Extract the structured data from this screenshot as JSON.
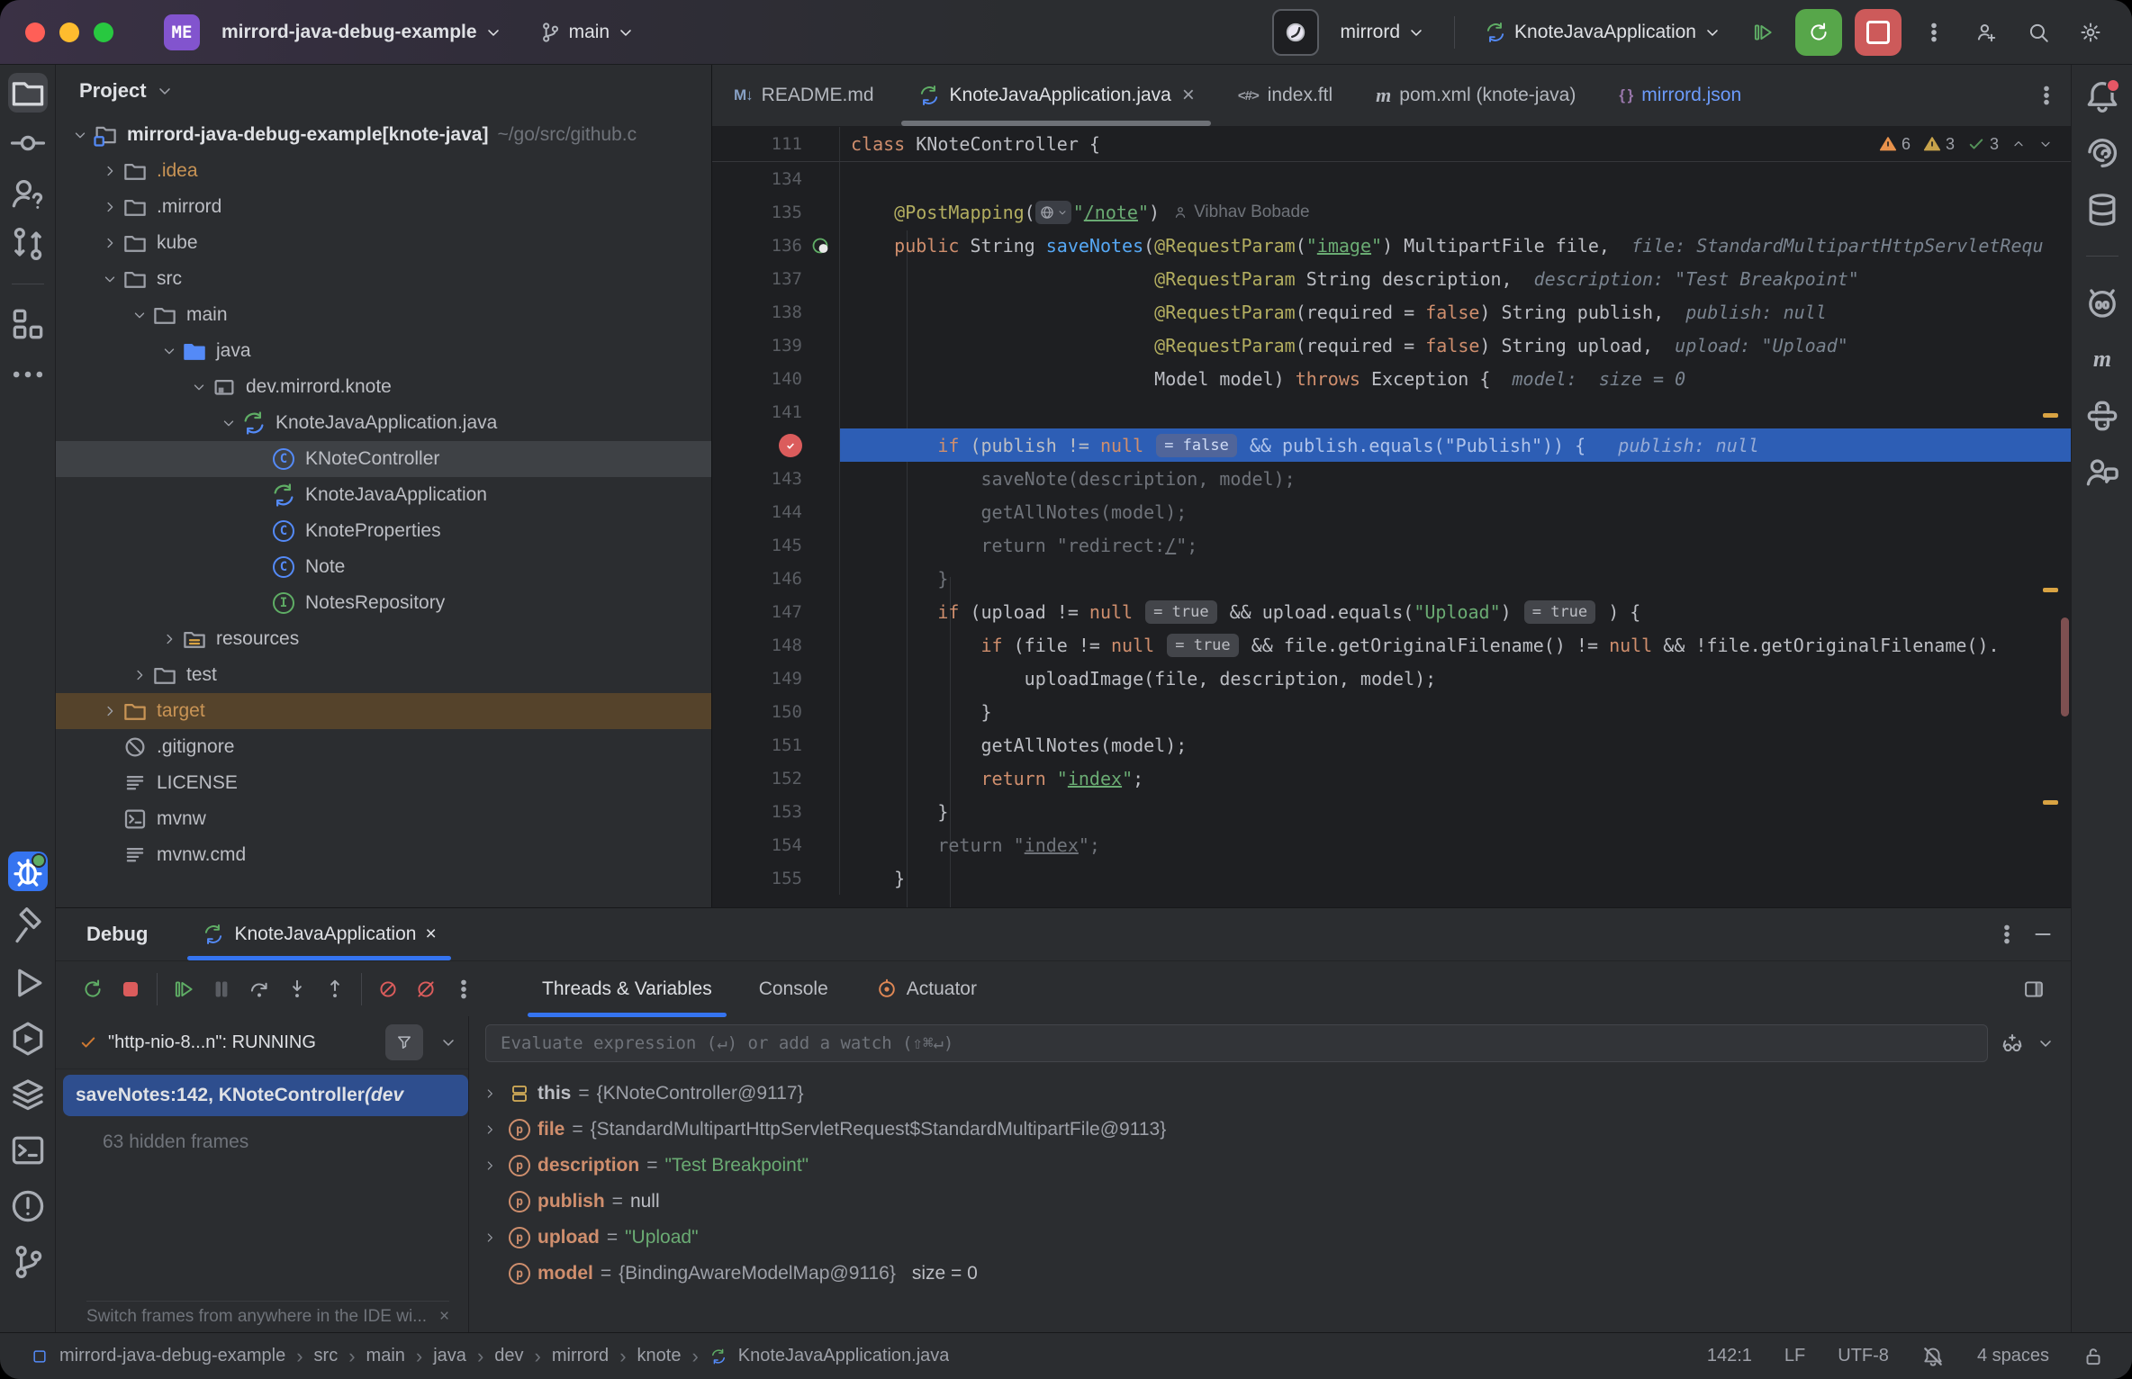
{
  "titlebar": {
    "project_badge": "ME",
    "project_name": "mirrord-java-debug-example",
    "branch_name": "main",
    "mirrord_selector": "mirrord",
    "run_configuration": "KnoteJavaApplication"
  },
  "editor_tabs": [
    {
      "label": "README.md",
      "icon": "markdown-icon"
    },
    {
      "label": "KnoteJavaApplication.java",
      "icon": "class-run-icon",
      "active": true
    },
    {
      "label": "index.ftl",
      "icon": "ftl-icon"
    },
    {
      "label": "pom.xml (knote-java)",
      "icon": "maven-icon"
    },
    {
      "label": "mirrord.json",
      "icon": "braces-icon",
      "accent": true
    }
  ],
  "project_panel": {
    "title": "Project",
    "tree": [
      {
        "label": "mirrord-java-debug-example",
        "suffix": " [knote-java]",
        "path": "~/go/src/github.c",
        "level": 0,
        "chevron": "open",
        "icon": "project-icon",
        "bold": true
      },
      {
        "label": ".idea",
        "level": 1,
        "chevron": "closed",
        "icon": "folder-icon",
        "excluded": true
      },
      {
        "label": ".mirrord",
        "level": 1,
        "chevron": "closed",
        "icon": "folder-icon"
      },
      {
        "label": "kube",
        "level": 1,
        "chevron": "closed",
        "icon": "folder-icon"
      },
      {
        "label": "src",
        "level": 1,
        "chevron": "open",
        "icon": "folder-icon"
      },
      {
        "label": "main",
        "level": 2,
        "chevron": "open",
        "icon": "folder-icon"
      },
      {
        "label": "java",
        "level": 3,
        "chevron": "open",
        "icon": "folder-src-icon"
      },
      {
        "label": "dev.mirrord.knote",
        "level": 4,
        "chevron": "open",
        "icon": "package-icon"
      },
      {
        "label": "KnoteJavaApplication.java",
        "level": 5,
        "chevron": "open",
        "icon": "class-run-icon"
      },
      {
        "label": "KNoteController",
        "level": 6,
        "icon": "class-icon",
        "selected": true
      },
      {
        "label": "KnoteJavaApplication",
        "level": 6,
        "icon": "class-run-icon"
      },
      {
        "label": "KnoteProperties",
        "level": 6,
        "icon": "class-icon"
      },
      {
        "label": "Note",
        "level": 6,
        "icon": "class-icon"
      },
      {
        "label": "NotesRepository",
        "level": 6,
        "icon": "interface-icon"
      },
      {
        "label": "resources",
        "level": 3,
        "chevron": "closed",
        "icon": "folder-resources-icon"
      },
      {
        "label": "test",
        "level": 2,
        "chevron": "closed",
        "icon": "folder-icon"
      },
      {
        "label": "target",
        "level": 1,
        "chevron": "closed",
        "icon": "folder-excluded-icon",
        "excluded": true,
        "row_excluded": true
      },
      {
        "label": ".gitignore",
        "level": 1,
        "icon": "ignored-icon"
      },
      {
        "label": "LICENSE",
        "level": 1,
        "icon": "text-file-icon"
      },
      {
        "label": "mvnw",
        "level": 1,
        "icon": "shell-file-icon"
      },
      {
        "label": "mvnw.cmd",
        "level": 1,
        "icon": "text-file-icon"
      }
    ]
  },
  "editor": {
    "sticky": {
      "n": "111",
      "seg": [
        [
          "k",
          "class"
        ],
        [
          "p",
          " KNoteController {"
        ]
      ]
    },
    "inspections": {
      "errors": "6",
      "warnings": "3",
      "passed": "3"
    },
    "lines": [
      {
        "n": "134",
        "seg": []
      },
      {
        "n": "135",
        "seg": [
          [
            "p",
            "    "
          ],
          [
            "a",
            "@PostMapping"
          ],
          [
            "p",
            "("
          ],
          [
            "globe",
            ""
          ],
          [
            "s",
            "\""
          ],
          [
            "su",
            "/note"
          ],
          [
            "s",
            "\""
          ],
          [
            "p",
            ")"
          ],
          [
            "author",
            "Vibhav Bobade"
          ]
        ]
      },
      {
        "n": "136",
        "gutter": "endpoint",
        "seg": [
          [
            "p",
            "    "
          ],
          [
            "k",
            "public"
          ],
          [
            "p",
            " String "
          ],
          [
            "f",
            "saveNotes"
          ],
          [
            "p",
            "("
          ],
          [
            "a",
            "@RequestParam"
          ],
          [
            "p",
            "("
          ],
          [
            "s",
            "\""
          ],
          [
            "su",
            "image"
          ],
          [
            "s",
            "\""
          ],
          [
            "p",
            ") MultipartFile file,"
          ],
          [
            "h",
            "  file: StandardMultipartHttpServletRequ"
          ]
        ]
      },
      {
        "n": "137",
        "seg": [
          [
            "p",
            "                            "
          ],
          [
            "a",
            "@RequestParam"
          ],
          [
            "p",
            " String description,"
          ],
          [
            "h",
            "  description: \"Test Breakpoint\""
          ]
        ]
      },
      {
        "n": "138",
        "seg": [
          [
            "p",
            "                            "
          ],
          [
            "a",
            "@RequestParam"
          ],
          [
            "p",
            "(required = "
          ],
          [
            "k",
            "false"
          ],
          [
            "p",
            ") String publish,"
          ],
          [
            "h",
            "  publish: null"
          ]
        ]
      },
      {
        "n": "139",
        "seg": [
          [
            "p",
            "                            "
          ],
          [
            "a",
            "@RequestParam"
          ],
          [
            "p",
            "(required = "
          ],
          [
            "k",
            "false"
          ],
          [
            "p",
            ") String upload,"
          ],
          [
            "h",
            "  upload: \"Upload\""
          ]
        ]
      },
      {
        "n": "140",
        "seg": [
          [
            "p",
            "                            Model model) "
          ],
          [
            "k",
            "throws"
          ],
          [
            "p",
            " Exception {"
          ],
          [
            "h",
            "  model:  size = 0"
          ]
        ]
      },
      {
        "n": "141",
        "seg": []
      },
      {
        "n": "142",
        "exec": true,
        "bp": true,
        "seg": [
          [
            "p",
            "        "
          ],
          [
            "k",
            "if"
          ],
          [
            "p",
            " (publish != "
          ],
          [
            "k",
            "null"
          ],
          [
            "p",
            " "
          ],
          [
            "chip",
            "= false"
          ],
          [
            "xp",
            " && publish.equals(\"Publish\")) {"
          ],
          [
            "xh",
            "   publish: null"
          ]
        ]
      },
      {
        "n": "143",
        "seg": [
          [
            "d",
            "            saveNote(description, model);"
          ]
        ]
      },
      {
        "n": "144",
        "seg": [
          [
            "d",
            "            getAllNotes(model);"
          ]
        ]
      },
      {
        "n": "145",
        "seg": [
          [
            "d",
            "            return \"redirect:"
          ],
          [
            "du",
            "/"
          ],
          [
            "d",
            "\";"
          ]
        ]
      },
      {
        "n": "146",
        "seg": [
          [
            "d",
            "        }"
          ]
        ]
      },
      {
        "n": "147",
        "seg": [
          [
            "p",
            "        "
          ],
          [
            "k",
            "if"
          ],
          [
            "p",
            " (upload != "
          ],
          [
            "k",
            "null"
          ],
          [
            "p",
            " "
          ],
          [
            "chip",
            "= true"
          ],
          [
            "p",
            " && upload.equals("
          ],
          [
            "s",
            "\"Upload\""
          ],
          [
            "p",
            ") "
          ],
          [
            "chip",
            "= true"
          ],
          [
            "p",
            " ) {"
          ]
        ]
      },
      {
        "n": "148",
        "seg": [
          [
            "p",
            "            "
          ],
          [
            "k",
            "if"
          ],
          [
            "p",
            " (file != "
          ],
          [
            "k",
            "null"
          ],
          [
            "p",
            " "
          ],
          [
            "chip",
            "= true"
          ],
          [
            "p",
            " && file.getOriginalFilename() != "
          ],
          [
            "k",
            "null"
          ],
          [
            "p",
            " && !file.getOriginalFilename()."
          ]
        ]
      },
      {
        "n": "149",
        "seg": [
          [
            "p",
            "                uploadImage(file, description, model);"
          ]
        ]
      },
      {
        "n": "150",
        "seg": [
          [
            "p",
            "            }"
          ]
        ]
      },
      {
        "n": "151",
        "seg": [
          [
            "p",
            "            getAllNotes(model);"
          ]
        ]
      },
      {
        "n": "152",
        "seg": [
          [
            "p",
            "            "
          ],
          [
            "k",
            "return"
          ],
          [
            "p",
            " "
          ],
          [
            "s",
            "\""
          ],
          [
            "su",
            "index"
          ],
          [
            "s",
            "\""
          ],
          [
            "p",
            ";"
          ]
        ]
      },
      {
        "n": "153",
        "seg": [
          [
            "p",
            "        }"
          ]
        ]
      },
      {
        "n": "154",
        "seg": [
          [
            "d",
            "        return \""
          ],
          [
            "du",
            "index"
          ],
          [
            "d",
            "\";"
          ]
        ]
      },
      {
        "n": "155",
        "seg": [
          [
            "p",
            "    }"
          ]
        ]
      }
    ]
  },
  "debug": {
    "panel_title": "Debug",
    "session_tab": "KnoteJavaApplication",
    "tabs": [
      {
        "label": "Threads & Variables",
        "active": true
      },
      {
        "label": "Console"
      },
      {
        "label": "Actuator",
        "icon": "actuator-icon"
      }
    ],
    "thread_status": "\"http-nio-8...n\": RUNNING",
    "frames": [
      {
        "label": "saveNotes:142, KNoteController ",
        "suffix": "(dev",
        "selected": true
      },
      {
        "label": "63 hidden frames",
        "dim": true
      }
    ],
    "watch_placeholder": "Evaluate expression (↵) or add a watch (⇧⌘↵)",
    "variables": [
      {
        "icon": "this-icon",
        "name": "this",
        "value": "{KNoteController@9117}",
        "kind": "ref",
        "expand": true,
        "name_white": true
      },
      {
        "icon": "param-icon",
        "name": "file",
        "value": "{StandardMultipartHttpServletRequest$StandardMultipartFile@9113}",
        "kind": "ref",
        "expand": true
      },
      {
        "icon": "param-icon",
        "name": "description",
        "value": "\"Test Breakpoint\"",
        "kind": "str",
        "expand": true
      },
      {
        "icon": "param-icon",
        "name": "publish",
        "value": "null",
        "kind": "plain"
      },
      {
        "icon": "param-icon",
        "name": "upload",
        "value": "\"Upload\"",
        "kind": "str",
        "expand": true
      },
      {
        "icon": "param-icon",
        "name": "model",
        "value": "{BindingAwareModelMap@9116}",
        "kind": "ref",
        "extra": "size = 0"
      }
    ],
    "hint": "Switch frames from anywhere in the IDE wi..."
  },
  "status_bar": {
    "breadcrumbs": [
      "mirrord-java-debug-example",
      "src",
      "main",
      "java",
      "dev",
      "mirrord",
      "knote"
    ],
    "breadcrumb_file": "KnoteJavaApplication.java",
    "caret": "142:1",
    "line_ending": "LF",
    "encoding": "UTF-8",
    "indent": "4 spaces"
  },
  "left_strip": {
    "top": [
      {
        "icon": "project-folder-icon",
        "active": true
      },
      {
        "icon": "commit-icon"
      },
      {
        "icon": "vcs-question-icon"
      },
      {
        "icon": "pull-request-icon"
      },
      {
        "divider": true
      },
      {
        "icon": "structure-icon"
      },
      {
        "icon": "more-icon"
      }
    ],
    "bottom": [
      {
        "icon": "debug-icon",
        "accent": true,
        "dot": true
      },
      {
        "icon": "build-icon"
      },
      {
        "icon": "run-icon"
      },
      {
        "icon": "services-icon"
      },
      {
        "icon": "layers-icon"
      },
      {
        "icon": "terminal-icon"
      },
      {
        "icon": "problems-icon"
      },
      {
        "icon": "git-branch-icon"
      }
    ]
  },
  "right_strip": [
    {
      "icon": "notifications-icon",
      "dot": true
    },
    {
      "icon": "ai-assistant-icon"
    },
    {
      "icon": "database-icon"
    },
    {
      "divider": true
    },
    {
      "icon": "gradle-icon"
    },
    {
      "icon": "maven-tool-icon"
    },
    {
      "icon": "python-icon"
    },
    {
      "icon": "code-with-me-icon"
    }
  ]
}
